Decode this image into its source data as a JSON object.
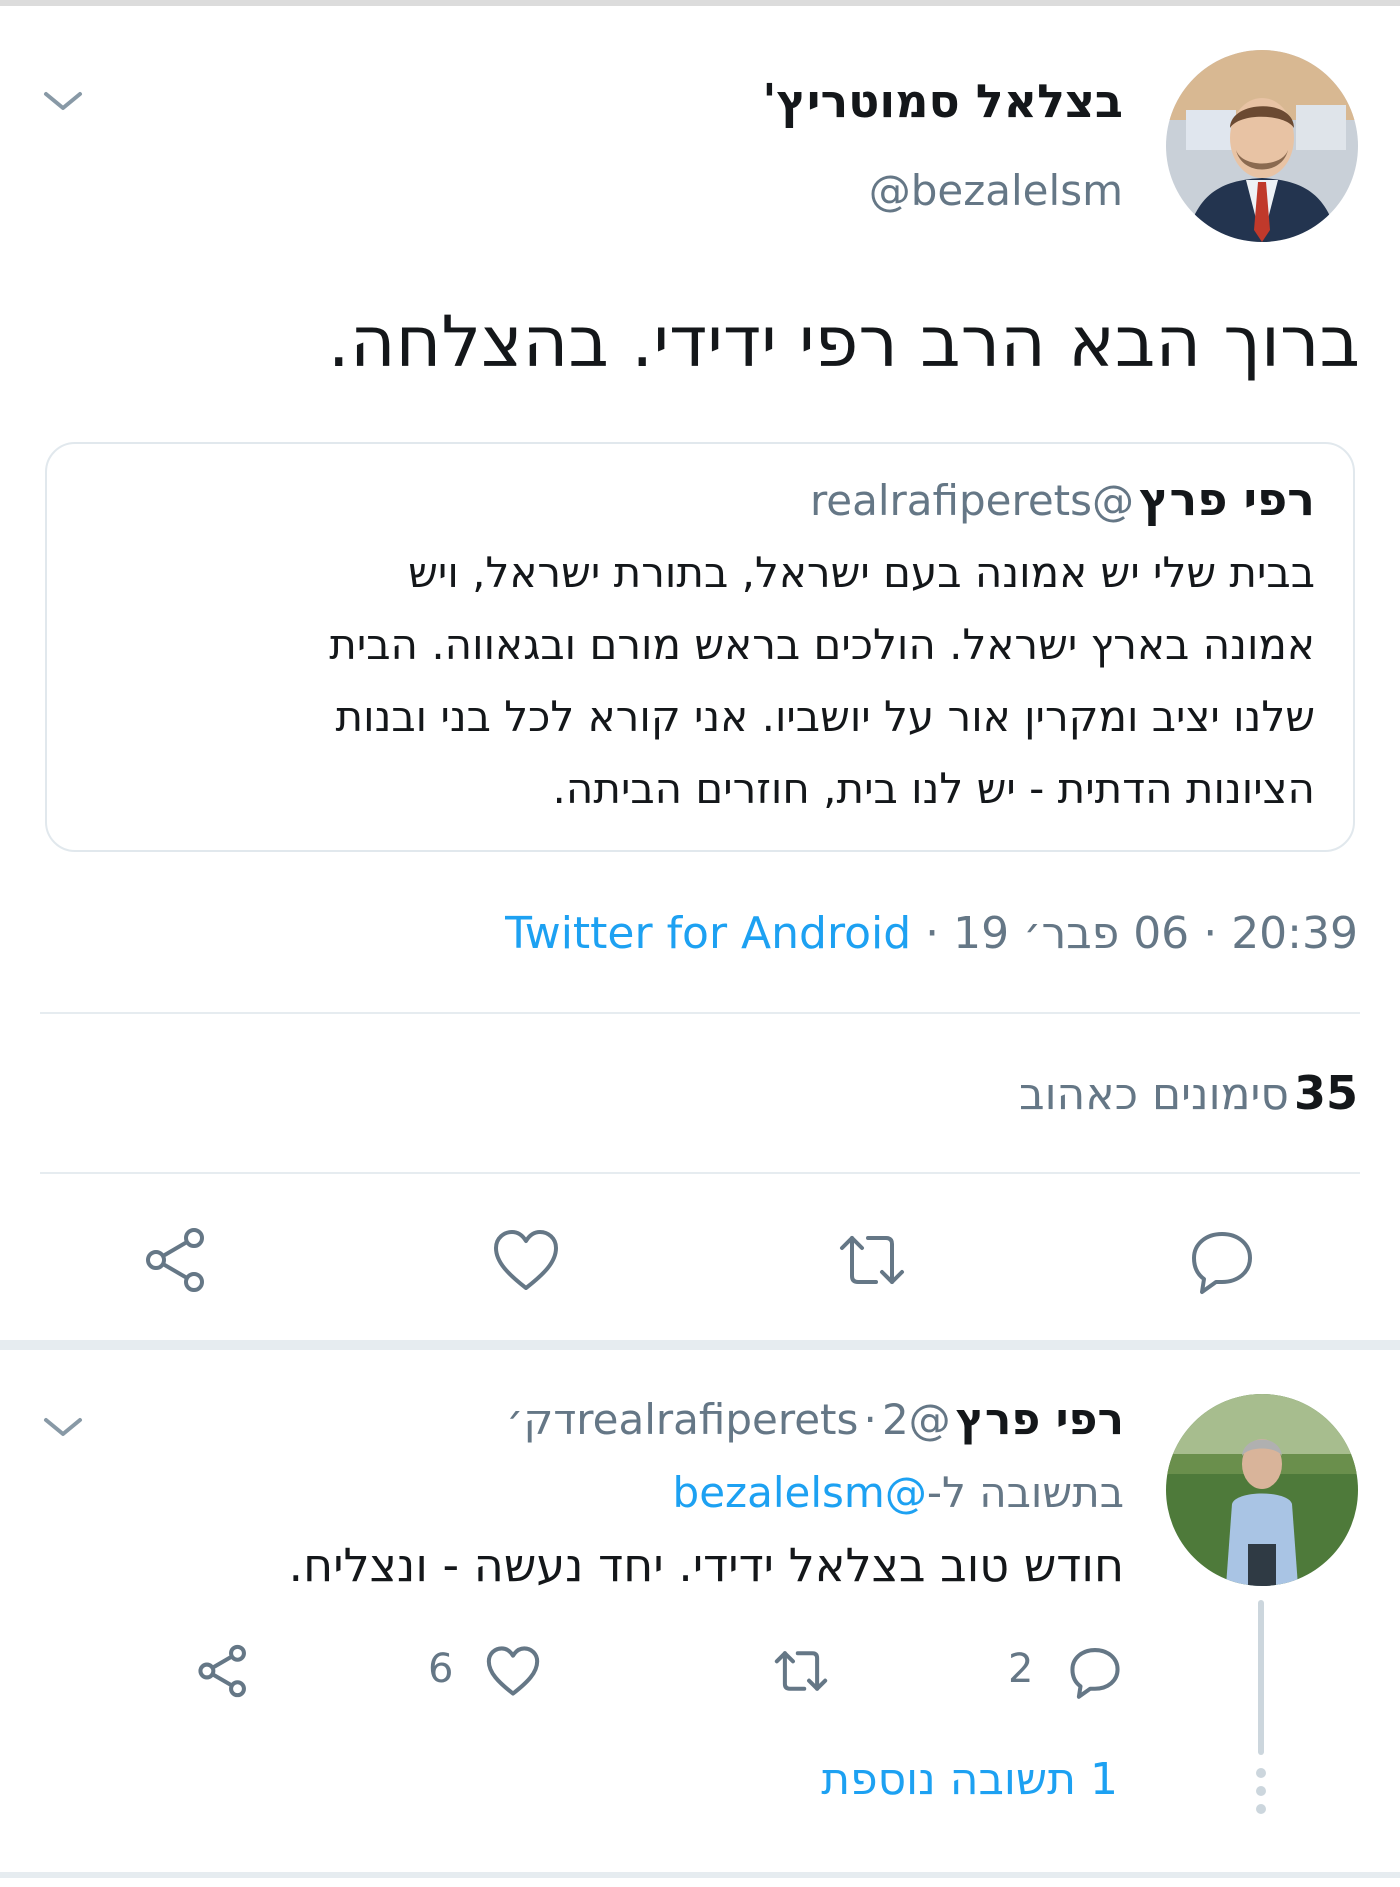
{
  "main_tweet": {
    "display_name": "בצלאל סמוטריץ'",
    "handle": "@bezalelsm",
    "text": "ברוך הבא הרב רפי ידידי. בהצלחה.",
    "quoted": {
      "display_name": "רפי פרץ",
      "handle": "@realrafiperets",
      "lines": [
        "בבית שלי יש אמונה בעם ישראל, בתורת ישראל, ויש",
        "אמונה בארץ ישראל. הולכים בראש מורם ובגאווה. הבית",
        "שלנו יציב ומקרין אור על יושביו. אני קורא לכל בני ובנות",
        "הציונות הדתית - יש לנו בית, חוזרים הביתה."
      ]
    },
    "time": "20:39",
    "date": "06 פבר׳ 19",
    "source": "Twitter for Android",
    "separator": "·",
    "likes_count": "35",
    "likes_label": "סימונים כאהוב",
    "actions": {
      "reply": "reply-icon",
      "retweet": "retweet-icon",
      "like": "heart-icon",
      "share": "share-icon"
    }
  },
  "reply_tweet": {
    "display_name": "רפי פרץ",
    "handle": "@realrafiperets",
    "time": "2דק׳",
    "separator": "·",
    "replying_to_label": "בתשובה ל-",
    "replying_to_handle": "@bezalelsm",
    "text": "חודש טוב בצלאל ידידי. יחד נעשה - ונצליח.",
    "reply_count": "2",
    "like_count": "6",
    "more_replies": "1 תשובה נוספת"
  },
  "colors": {
    "accent": "#1da1f2",
    "secondary_text": "#657786",
    "primary_text": "#14171a",
    "divider": "#e6ecf0"
  }
}
